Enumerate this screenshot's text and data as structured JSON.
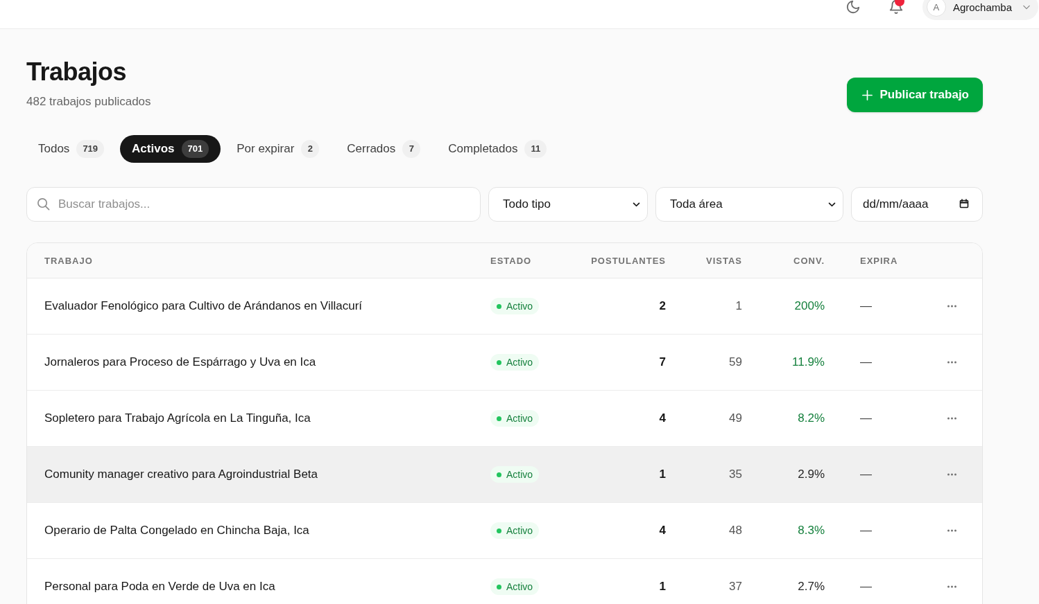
{
  "header": {
    "notifications": {
      "unread": true
    },
    "user": {
      "initial": "A",
      "name": "Agrochamba"
    }
  },
  "page": {
    "title": "Trabajos",
    "subtitle": "482 trabajos publicados",
    "primary_button": {
      "label": "Publicar trabajo"
    }
  },
  "tabs": [
    {
      "label": "Todos",
      "count": "719",
      "selected": false
    },
    {
      "label": "Activos",
      "count": "701",
      "selected": true
    },
    {
      "label": "Por expirar",
      "count": "2",
      "selected": false
    },
    {
      "label": "Cerrados",
      "count": "7",
      "selected": false
    },
    {
      "label": "Completados",
      "count": "11",
      "selected": false
    }
  ],
  "filters": {
    "search": {
      "placeholder": "Buscar trabajos..."
    },
    "type_select": {
      "value": "Todo tipo"
    },
    "area_select": {
      "value": "Toda área"
    },
    "date": {
      "placeholder": "dd/mm/aaaa"
    }
  },
  "table": {
    "columns": [
      "TRABAJO",
      "ESTADO",
      "POSTULANTES",
      "VISTAS",
      "CONV.",
      "EXPIRA"
    ],
    "rows": [
      {
        "title": "Evaluador Fenológico para Cultivo de Arándanos en Villacurí",
        "status": {
          "label": "Activo",
          "kind": "active"
        },
        "applicants": "2",
        "views": "1",
        "conversion": "200%",
        "conversion_good": true,
        "expires": "—",
        "highlighted": false
      },
      {
        "title": "Jornaleros para Proceso de Espárrago y Uva en Ica",
        "status": {
          "label": "Activo",
          "kind": "active"
        },
        "applicants": "7",
        "views": "59",
        "conversion": "11.9%",
        "conversion_good": true,
        "expires": "—",
        "highlighted": false
      },
      {
        "title": "Sopletero para Trabajo Agrícola en La Tinguña, Ica",
        "status": {
          "label": "Activo",
          "kind": "active"
        },
        "applicants": "4",
        "views": "49",
        "conversion": "8.2%",
        "conversion_good": true,
        "expires": "—",
        "highlighted": false
      },
      {
        "title": "Comunity manager creativo para Agroindustrial Beta",
        "status": {
          "label": "Activo",
          "kind": "active"
        },
        "applicants": "1",
        "views": "35",
        "conversion": "2.9%",
        "conversion_good": false,
        "expires": "—",
        "highlighted": true
      },
      {
        "title": "Operario de Palta Congelado en Chincha Baja, Ica",
        "status": {
          "label": "Activo",
          "kind": "active"
        },
        "applicants": "4",
        "views": "48",
        "conversion": "8.3%",
        "conversion_good": true,
        "expires": "—",
        "highlighted": false
      },
      {
        "title": "Personal para Poda en Verde de Uva en Ica",
        "status": {
          "label": "Activo",
          "kind": "active"
        },
        "applicants": "1",
        "views": "37",
        "conversion": "2.7%",
        "conversion_good": false,
        "expires": "—",
        "highlighted": false
      }
    ]
  }
}
